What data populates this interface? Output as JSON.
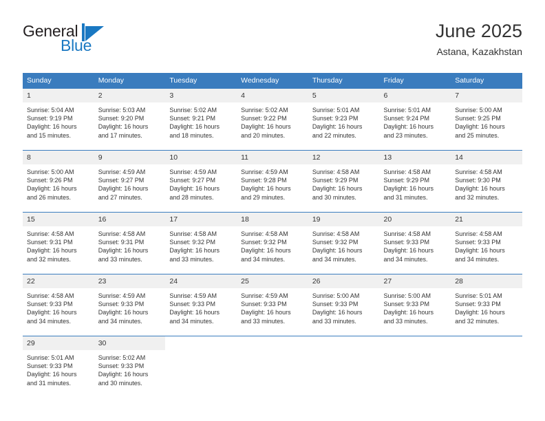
{
  "brand": {
    "name_part1": "General",
    "name_part2": "Blue",
    "mark": "flag-triangle-icon"
  },
  "header": {
    "title": "June 2025",
    "subtitle": "Astana, Kazakhstan"
  },
  "calendar": {
    "weekday_headers": [
      "Sunday",
      "Monday",
      "Tuesday",
      "Wednesday",
      "Thursday",
      "Friday",
      "Saturday"
    ],
    "header_bg": "#3a7cbe",
    "daynum_bg": "#f0f0f0",
    "accent": "#1a78c2",
    "weeks": [
      [
        {
          "day": "1",
          "sunrise": "Sunrise: 5:04 AM",
          "sunset": "Sunset: 9:19 PM",
          "daylight_line1": "Daylight: 16 hours",
          "daylight_line2": "and 15 minutes."
        },
        {
          "day": "2",
          "sunrise": "Sunrise: 5:03 AM",
          "sunset": "Sunset: 9:20 PM",
          "daylight_line1": "Daylight: 16 hours",
          "daylight_line2": "and 17 minutes."
        },
        {
          "day": "3",
          "sunrise": "Sunrise: 5:02 AM",
          "sunset": "Sunset: 9:21 PM",
          "daylight_line1": "Daylight: 16 hours",
          "daylight_line2": "and 18 minutes."
        },
        {
          "day": "4",
          "sunrise": "Sunrise: 5:02 AM",
          "sunset": "Sunset: 9:22 PM",
          "daylight_line1": "Daylight: 16 hours",
          "daylight_line2": "and 20 minutes."
        },
        {
          "day": "5",
          "sunrise": "Sunrise: 5:01 AM",
          "sunset": "Sunset: 9:23 PM",
          "daylight_line1": "Daylight: 16 hours",
          "daylight_line2": "and 22 minutes."
        },
        {
          "day": "6",
          "sunrise": "Sunrise: 5:01 AM",
          "sunset": "Sunset: 9:24 PM",
          "daylight_line1": "Daylight: 16 hours",
          "daylight_line2": "and 23 minutes."
        },
        {
          "day": "7",
          "sunrise": "Sunrise: 5:00 AM",
          "sunset": "Sunset: 9:25 PM",
          "daylight_line1": "Daylight: 16 hours",
          "daylight_line2": "and 25 minutes."
        }
      ],
      [
        {
          "day": "8",
          "sunrise": "Sunrise: 5:00 AM",
          "sunset": "Sunset: 9:26 PM",
          "daylight_line1": "Daylight: 16 hours",
          "daylight_line2": "and 26 minutes."
        },
        {
          "day": "9",
          "sunrise": "Sunrise: 4:59 AM",
          "sunset": "Sunset: 9:27 PM",
          "daylight_line1": "Daylight: 16 hours",
          "daylight_line2": "and 27 minutes."
        },
        {
          "day": "10",
          "sunrise": "Sunrise: 4:59 AM",
          "sunset": "Sunset: 9:27 PM",
          "daylight_line1": "Daylight: 16 hours",
          "daylight_line2": "and 28 minutes."
        },
        {
          "day": "11",
          "sunrise": "Sunrise: 4:59 AM",
          "sunset": "Sunset: 9:28 PM",
          "daylight_line1": "Daylight: 16 hours",
          "daylight_line2": "and 29 minutes."
        },
        {
          "day": "12",
          "sunrise": "Sunrise: 4:58 AM",
          "sunset": "Sunset: 9:29 PM",
          "daylight_line1": "Daylight: 16 hours",
          "daylight_line2": "and 30 minutes."
        },
        {
          "day": "13",
          "sunrise": "Sunrise: 4:58 AM",
          "sunset": "Sunset: 9:29 PM",
          "daylight_line1": "Daylight: 16 hours",
          "daylight_line2": "and 31 minutes."
        },
        {
          "day": "14",
          "sunrise": "Sunrise: 4:58 AM",
          "sunset": "Sunset: 9:30 PM",
          "daylight_line1": "Daylight: 16 hours",
          "daylight_line2": "and 32 minutes."
        }
      ],
      [
        {
          "day": "15",
          "sunrise": "Sunrise: 4:58 AM",
          "sunset": "Sunset: 9:31 PM",
          "daylight_line1": "Daylight: 16 hours",
          "daylight_line2": "and 32 minutes."
        },
        {
          "day": "16",
          "sunrise": "Sunrise: 4:58 AM",
          "sunset": "Sunset: 9:31 PM",
          "daylight_line1": "Daylight: 16 hours",
          "daylight_line2": "and 33 minutes."
        },
        {
          "day": "17",
          "sunrise": "Sunrise: 4:58 AM",
          "sunset": "Sunset: 9:32 PM",
          "daylight_line1": "Daylight: 16 hours",
          "daylight_line2": "and 33 minutes."
        },
        {
          "day": "18",
          "sunrise": "Sunrise: 4:58 AM",
          "sunset": "Sunset: 9:32 PM",
          "daylight_line1": "Daylight: 16 hours",
          "daylight_line2": "and 34 minutes."
        },
        {
          "day": "19",
          "sunrise": "Sunrise: 4:58 AM",
          "sunset": "Sunset: 9:32 PM",
          "daylight_line1": "Daylight: 16 hours",
          "daylight_line2": "and 34 minutes."
        },
        {
          "day": "20",
          "sunrise": "Sunrise: 4:58 AM",
          "sunset": "Sunset: 9:33 PM",
          "daylight_line1": "Daylight: 16 hours",
          "daylight_line2": "and 34 minutes."
        },
        {
          "day": "21",
          "sunrise": "Sunrise: 4:58 AM",
          "sunset": "Sunset: 9:33 PM",
          "daylight_line1": "Daylight: 16 hours",
          "daylight_line2": "and 34 minutes."
        }
      ],
      [
        {
          "day": "22",
          "sunrise": "Sunrise: 4:58 AM",
          "sunset": "Sunset: 9:33 PM",
          "daylight_line1": "Daylight: 16 hours",
          "daylight_line2": "and 34 minutes."
        },
        {
          "day": "23",
          "sunrise": "Sunrise: 4:59 AM",
          "sunset": "Sunset: 9:33 PM",
          "daylight_line1": "Daylight: 16 hours",
          "daylight_line2": "and 34 minutes."
        },
        {
          "day": "24",
          "sunrise": "Sunrise: 4:59 AM",
          "sunset": "Sunset: 9:33 PM",
          "daylight_line1": "Daylight: 16 hours",
          "daylight_line2": "and 34 minutes."
        },
        {
          "day": "25",
          "sunrise": "Sunrise: 4:59 AM",
          "sunset": "Sunset: 9:33 PM",
          "daylight_line1": "Daylight: 16 hours",
          "daylight_line2": "and 33 minutes."
        },
        {
          "day": "26",
          "sunrise": "Sunrise: 5:00 AM",
          "sunset": "Sunset: 9:33 PM",
          "daylight_line1": "Daylight: 16 hours",
          "daylight_line2": "and 33 minutes."
        },
        {
          "day": "27",
          "sunrise": "Sunrise: 5:00 AM",
          "sunset": "Sunset: 9:33 PM",
          "daylight_line1": "Daylight: 16 hours",
          "daylight_line2": "and 33 minutes."
        },
        {
          "day": "28",
          "sunrise": "Sunrise: 5:01 AM",
          "sunset": "Sunset: 9:33 PM",
          "daylight_line1": "Daylight: 16 hours",
          "daylight_line2": "and 32 minutes."
        }
      ],
      [
        {
          "day": "29",
          "sunrise": "Sunrise: 5:01 AM",
          "sunset": "Sunset: 9:33 PM",
          "daylight_line1": "Daylight: 16 hours",
          "daylight_line2": "and 31 minutes."
        },
        {
          "day": "30",
          "sunrise": "Sunrise: 5:02 AM",
          "sunset": "Sunset: 9:33 PM",
          "daylight_line1": "Daylight: 16 hours",
          "daylight_line2": "and 30 minutes."
        },
        {
          "day": "",
          "sunrise": "",
          "sunset": "",
          "daylight_line1": "",
          "daylight_line2": ""
        },
        {
          "day": "",
          "sunrise": "",
          "sunset": "",
          "daylight_line1": "",
          "daylight_line2": ""
        },
        {
          "day": "",
          "sunrise": "",
          "sunset": "",
          "daylight_line1": "",
          "daylight_line2": ""
        },
        {
          "day": "",
          "sunrise": "",
          "sunset": "",
          "daylight_line1": "",
          "daylight_line2": ""
        },
        {
          "day": "",
          "sunrise": "",
          "sunset": "",
          "daylight_line1": "",
          "daylight_line2": ""
        }
      ]
    ]
  }
}
